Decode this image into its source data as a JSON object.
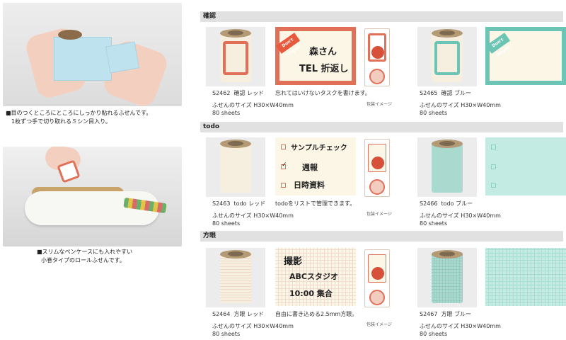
{
  "left": {
    "caption1_line1": "■目のつくところにところにしっかり貼れるふせんです。",
    "caption1_line2": "1枚ずつ手で切り取れるミシン目入り。",
    "caption2_line1": "■スリムなペンケースにも入れやすい",
    "caption2_line2": "小巻タイプのロールふせんです。"
  },
  "sections": [
    {
      "header": "確認",
      "red": {
        "code": "S2462",
        "name": "確認 レッド",
        "size": "ふせんのサイズ H30×W40mm",
        "count": "80 sheets"
      },
      "blue": {
        "code": "S2465",
        "name": "確認 ブルー",
        "size": "ふせんのサイズ H30×W40mm",
        "count": "80 sheets"
      },
      "desc": "忘れてはいけないタスクを書けます。",
      "pkg_label": "包装イメージ",
      "badge": "Don't forget!",
      "sample_line1": "森さん",
      "sample_line2": "TEL 折返し"
    },
    {
      "header": "todo",
      "red": {
        "code": "S2463",
        "name": "todo レッド",
        "size": "ふせんのサイズ H30×W40mm",
        "count": "80 sheets"
      },
      "blue": {
        "code": "S2466",
        "name": "todo ブルー",
        "size": "ふせんのサイズ H30×W40mm",
        "count": "80 sheets"
      },
      "desc": "todoをリストで管理できます。",
      "pkg_label": "包装イメージ",
      "sample_items": [
        "サンプルチェック",
        "週報",
        "日時資料"
      ]
    },
    {
      "header": "方眼",
      "red": {
        "code": "S2464",
        "name": "方眼 レッド",
        "size": "ふせんのサイズ H30×W40mm",
        "count": "80 sheets"
      },
      "blue": {
        "code": "S2467",
        "name": "方眼 ブルー",
        "size": "ふせんのサイズ H30×W40mm",
        "count": "80 sheets"
      },
      "desc": "自由に書き込める2.5mm方眼。",
      "pkg_label": "包装イメージ",
      "sample_line1": "撮影",
      "sample_line2": "ABCスタジオ",
      "sample_line3": "10:00 集合"
    }
  ],
  "colors": {
    "red_accent": "#e07058",
    "blue_accent": "#6cc4b5",
    "paper": "#fbf6e6"
  }
}
